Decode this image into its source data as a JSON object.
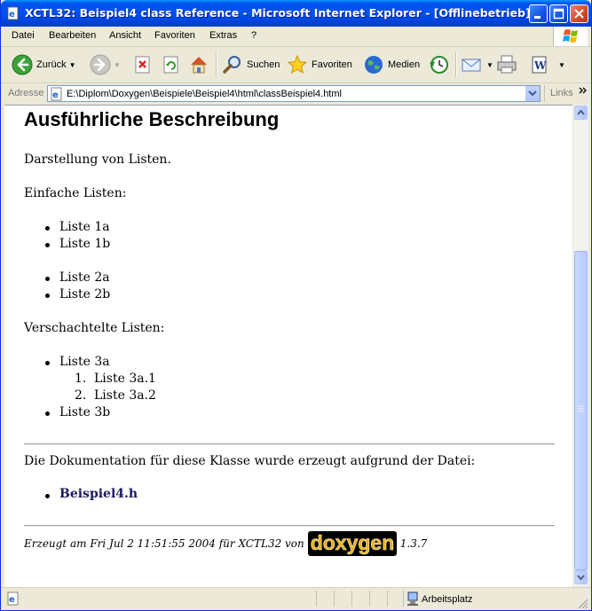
{
  "window": {
    "title": "XCTL32: Beispiel4 class Reference - Microsoft Internet Explorer - [Offlinebetrieb]"
  },
  "menu": [
    "Datei",
    "Bearbeiten",
    "Ansicht",
    "Favoriten",
    "Extras",
    "?"
  ],
  "toolbar": {
    "back": "Zurück",
    "search": "Suchen",
    "favorites": "Favoriten",
    "media": "Medien"
  },
  "address": {
    "label": "Adresse",
    "url": "E:\\Diplom\\Doxygen\\Beispiele\\Beispiel4\\html\\classBeispiel4.html",
    "links": "Links"
  },
  "content": {
    "heading": "Ausführliche Beschreibung",
    "intro": "Darstellung von Listen.",
    "simple_title": "Einfache Listen:",
    "list1": [
      "Liste 1a",
      "Liste 1b"
    ],
    "list2": [
      "Liste 2a",
      "Liste 2b"
    ],
    "nested_title": "Verschachtelte Listen:",
    "nested_item_3a": "Liste 3a",
    "nested_sub": [
      "Liste 3a.1",
      "Liste 3a.2"
    ],
    "nested_sub_numbers": [
      "1.",
      "2."
    ],
    "nested_item_3b": "Liste 3b",
    "doc_text": "Die Dokumentation für diese Klasse wurde erzeugt aufgrund der Datei:",
    "file_link": "Beispiel4.h",
    "footer_prefix": "Erzeugt am Fri Jul 2 11:51:55 2004 für XCTL32 von",
    "footer_logo": "doxygen",
    "footer_version": "1.3.7"
  },
  "status": {
    "zone": "Arbeitsplatz"
  }
}
